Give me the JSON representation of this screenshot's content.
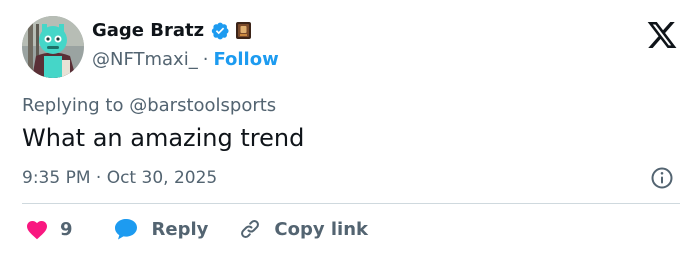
{
  "author": {
    "display_name": "Gage Bratz",
    "handle": "@NFTmaxi_",
    "separator": "·",
    "follow_label": "Follow"
  },
  "reply_to": {
    "prefix": "Replying to",
    "handle": "@barstoolsports"
  },
  "tweet": {
    "text": "What an amazing trend",
    "timestamp": "9:35 PM · Oct 30, 2025"
  },
  "actions": {
    "like_count": "9",
    "reply_label": "Reply",
    "copy_label": "Copy link"
  },
  "icons": {
    "verified": "verified-badge-icon",
    "affiliate": "affiliate-badge-icon",
    "brand": "x-logo-icon",
    "info": "info-icon",
    "like": "heart-icon",
    "reply": "speech-bubble-icon",
    "copy": "link-icon"
  },
  "colors": {
    "accent": "#1d9bf0",
    "like": "#f91880",
    "text": "#0f1419",
    "muted": "#536471",
    "divider": "#cfd9de"
  }
}
